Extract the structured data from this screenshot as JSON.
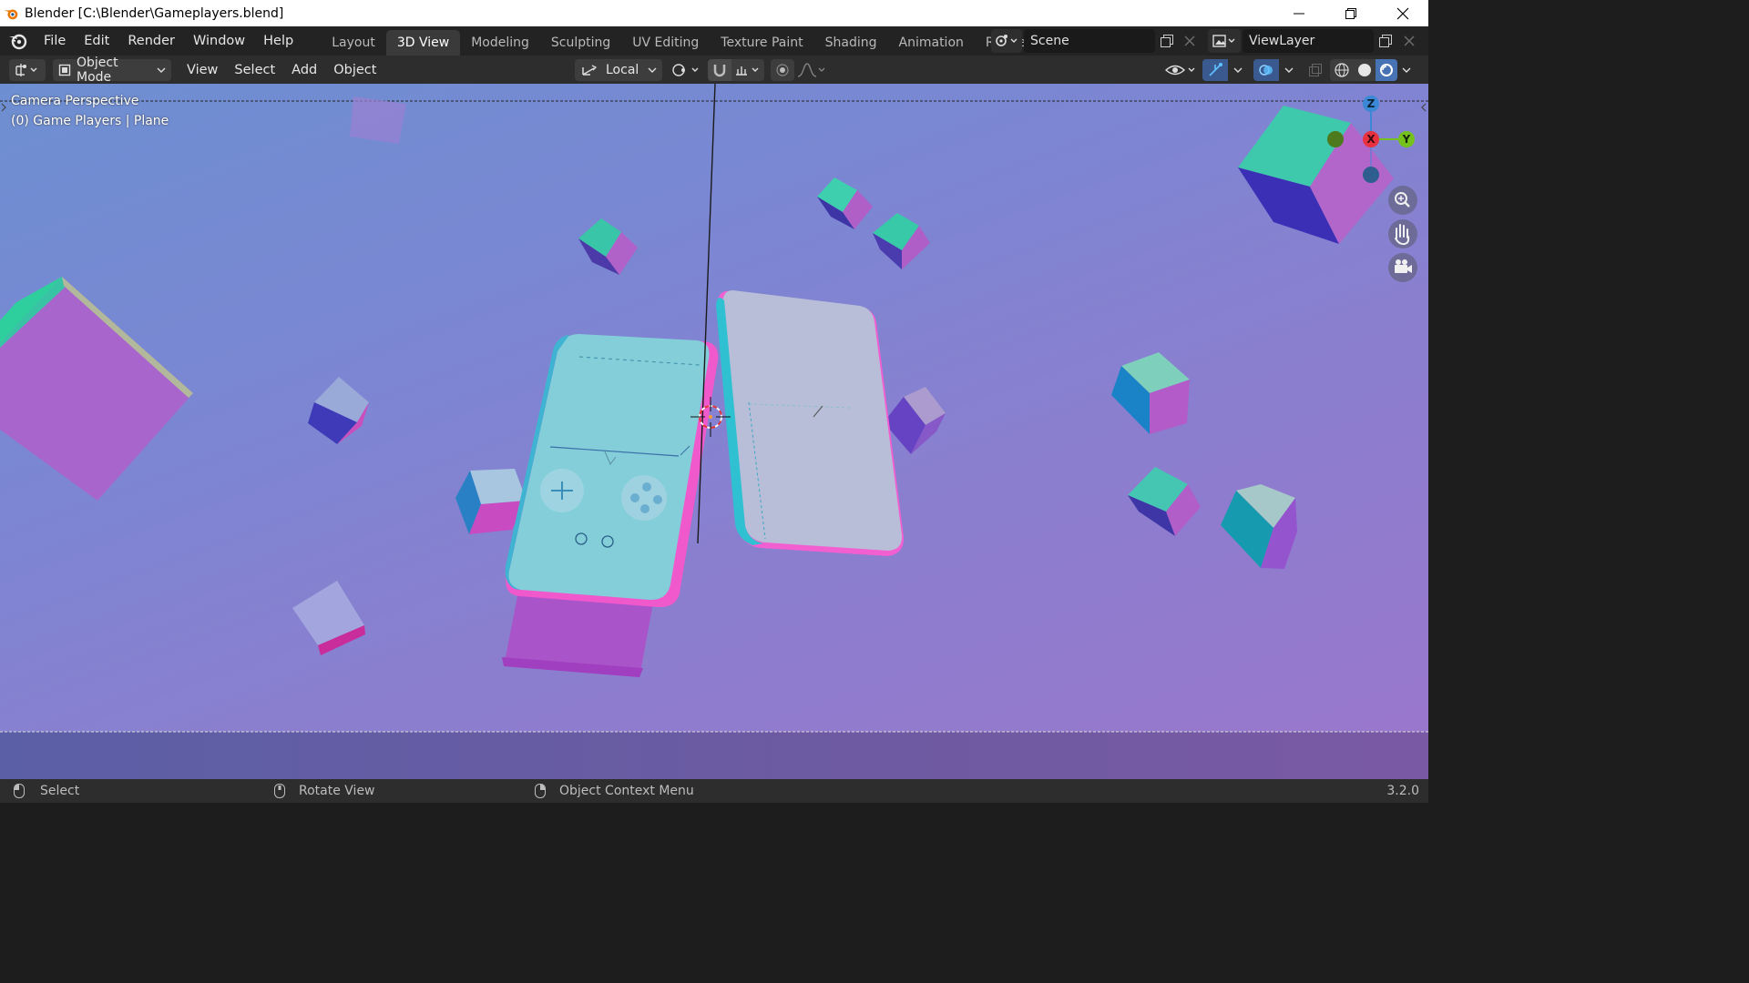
{
  "window": {
    "title": "Blender [C:\\Blender\\Gameplayers.blend]",
    "minimize_icon": "minimize-icon",
    "maximize_icon": "restore-icon",
    "close_icon": "close-icon"
  },
  "topbar": {
    "menus": [
      "File",
      "Edit",
      "Render",
      "Window",
      "Help"
    ],
    "workspaces": [
      "Layout",
      "3D View",
      "Modeling",
      "Sculpting",
      "UV Editing",
      "Texture Paint",
      "Shading",
      "Animation",
      "Renderin"
    ],
    "active_workspace": "3D View",
    "scene": "Scene",
    "view_layer": "ViewLayer"
  },
  "viewport_header": {
    "mode": "Object Mode",
    "menus": [
      "View",
      "Select",
      "Add",
      "Object"
    ],
    "transform_orientation": "Local"
  },
  "viewport": {
    "camera_label": "Camera Perspective",
    "object_label": "(0) Game Players | Plane",
    "gizmo_axes": {
      "x": "X",
      "y": "Y",
      "z": "Z"
    },
    "colors": {
      "x_axis": "#e8323f",
      "y_axis": "#76c21d",
      "z_axis": "#3a88d6"
    }
  },
  "statusbar": {
    "select": "Select",
    "rotate": "Rotate View",
    "context": "Object Context Menu",
    "version": "3.2.0"
  }
}
